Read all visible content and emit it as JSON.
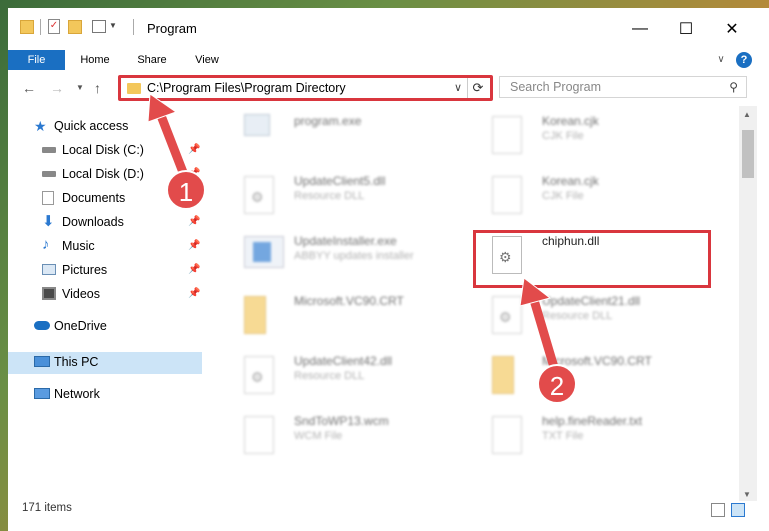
{
  "window": {
    "title": "Program",
    "controls": {
      "minimize": "—",
      "maximize": "☐",
      "close": "✕"
    }
  },
  "ribbon": {
    "tabs": [
      "File",
      "Home",
      "Share",
      "View"
    ],
    "expand_icon": "chevron-down-icon",
    "help_icon": "?"
  },
  "address_bar": {
    "path": "C:\\Program Files\\Program Directory",
    "refresh_icon": "⟳"
  },
  "search": {
    "placeholder": "Search Program"
  },
  "nav_pane": {
    "items": [
      {
        "label": "Quick access",
        "icon": "star-icon",
        "pinned": false
      },
      {
        "label": "Local Disk (C:)",
        "icon": "drive-icon",
        "pinned": true
      },
      {
        "label": "Local Disk (D:)",
        "icon": "drive-icon",
        "pinned": true
      },
      {
        "label": "Documents",
        "icon": "documents-icon",
        "pinned": true
      },
      {
        "label": "Downloads",
        "icon": "download-icon",
        "pinned": true
      },
      {
        "label": "Music",
        "icon": "music-icon",
        "pinned": true
      },
      {
        "label": "Pictures",
        "icon": "pictures-icon",
        "pinned": true
      },
      {
        "label": "Videos",
        "icon": "videos-icon",
        "pinned": true
      },
      {
        "label": "OneDrive",
        "icon": "cloud-icon",
        "pinned": false
      },
      {
        "label": "This PC",
        "icon": "computer-icon",
        "pinned": false,
        "selected": true
      },
      {
        "label": "Network",
        "icon": "network-icon",
        "pinned": false
      }
    ]
  },
  "files": [
    {
      "name": "program.exe",
      "type": "",
      "icon": "exe-icon"
    },
    {
      "name": "Korean.cjk",
      "type": "CJK File",
      "icon": "document-icon"
    },
    {
      "name": "UpdateClient5.dll",
      "type": "Resource DLL",
      "icon": "dll-icon"
    },
    {
      "name": "Korean.cjk",
      "type": "CJK File",
      "icon": "document-icon"
    },
    {
      "name": "UpdateInstaller.exe",
      "type": "ABBYY updates installer",
      "icon": "installer-icon"
    },
    {
      "name": "chiphun.dll",
      "type": "",
      "icon": "dll-icon",
      "highlighted": true
    },
    {
      "name": "Microsoft.VC90.CRT",
      "type": "",
      "icon": "folder-icon"
    },
    {
      "name": "UpdateClient21.dll",
      "type": "Resource DLL",
      "icon": "dll-icon"
    },
    {
      "name": "UpdateClient42.dll",
      "type": "Resource DLL",
      "icon": "dll-icon"
    },
    {
      "name": "Microsoft.VC90.CRT",
      "type": "",
      "icon": "folder-icon"
    },
    {
      "name": "SndToWP13.wcm",
      "type": "WCM File",
      "icon": "document-icon"
    },
    {
      "name": "help.fineReader.txt",
      "type": "TXT File",
      "icon": "document-icon"
    }
  ],
  "status": {
    "item_count": "171 items"
  },
  "annotations": {
    "step1": "1",
    "step2": "2",
    "color": "#e24b4b"
  }
}
